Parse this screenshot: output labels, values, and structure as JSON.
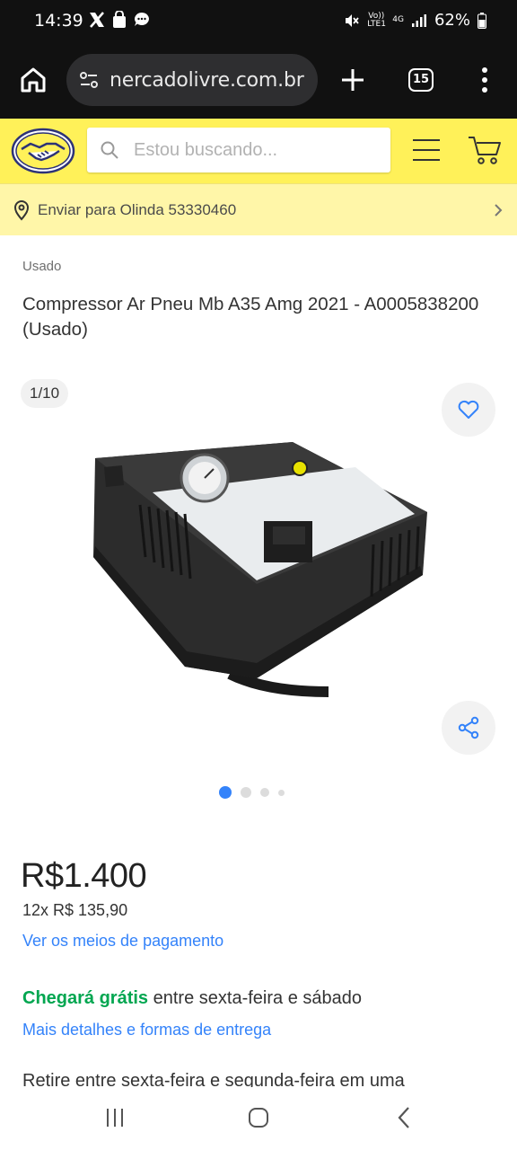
{
  "status_bar": {
    "time": "14:39",
    "battery": "62%",
    "network": "4G",
    "volte": "Vo)) LTE1"
  },
  "browser": {
    "url": "nercadolivre.com.br",
    "tab_count": "15"
  },
  "header": {
    "search_placeholder": "Estou buscando..."
  },
  "delivery": {
    "text": "Enviar para Olinda 53330460"
  },
  "product": {
    "condition": "Usado",
    "title": "Compressor Ar Pneu Mb A35 Amg 2021 - A0005838200 (Usado)",
    "image_counter": "1/10",
    "price_currency": "R$",
    "price_value": "1.400",
    "installments": "12x R$ 135,90",
    "payment_link": "Ver os meios de pagamento",
    "shipping_highlight": "Chegará grátis",
    "shipping_rest": "entre sexta-feira e sábado",
    "delivery_details_link": "Mais detalhes e formas de entrega",
    "pickup_text": "Retire entre sexta-feira e segunda-feira em uma"
  },
  "carousel": {
    "current": 1,
    "dots": 4
  },
  "colors": {
    "ml_yellow": "#fff159",
    "delivery_bg": "#fff6a8",
    "link_blue": "#3483fa",
    "green": "#00a650"
  }
}
